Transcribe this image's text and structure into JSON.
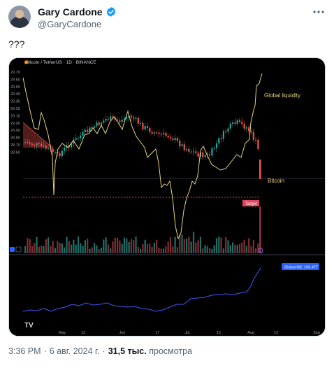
{
  "author": {
    "name": "Gary Cardone",
    "handle": "@GaryCardone",
    "verified": true,
    "more_icon": "ellipsis-icon"
  },
  "tweet": {
    "text": "???"
  },
  "chart_header": {
    "symbol_line": "Bitcoin / TetherUS · 1D · BINANCE"
  },
  "chart_annotations": {
    "liquidity_label": "Global liquidity",
    "bitcoin_label": "Bitcoin",
    "target_label": "Target",
    "badge_label": "Global M2: 106.47T"
  },
  "chart_data": {
    "type": "line",
    "y_ticks": [
      "29.70",
      "29.60",
      "29.50",
      "29.40",
      "29.30",
      "29.20",
      "29.10",
      "29.00",
      "28.90",
      "28.80",
      "28.70",
      "28.60"
    ],
    "x_ticks": [
      "May",
      "13",
      "Jun",
      "17",
      "Jul",
      "15",
      "Aug",
      "12",
      "Sep"
    ],
    "series": [
      {
        "name": "Global liquidity",
        "color": "#e6d37a"
      }
    ]
  },
  "colors": {
    "up": "#26a69a",
    "down": "#ef5350",
    "liquidity": "#e6d37a",
    "m2": "#3d5afe",
    "target_bg": "#e0445a",
    "badge_bg": "#2962ff",
    "accent": "#1d9bf0"
  },
  "footer": {
    "time": "3:36 PM",
    "date": "6 авг. 2024 г.",
    "views_count": "31,5 тыс.",
    "views_label": "просмотра"
  }
}
